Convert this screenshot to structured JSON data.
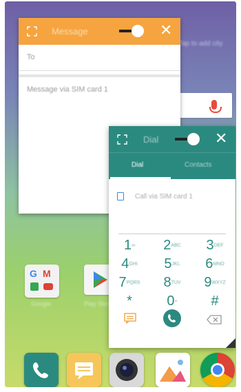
{
  "message_window": {
    "title": "Message",
    "to_label": "To",
    "compose_placeholder": "Message via SIM card 1"
  },
  "dial_window": {
    "title": "Dial",
    "tabs": [
      "Dial",
      "Contacts"
    ],
    "sim_hint": "Call via SIM card 1",
    "keys": [
      {
        "d": "1",
        "s": "∞"
      },
      {
        "d": "2",
        "s": "ABC"
      },
      {
        "d": "3",
        "s": "DEF"
      },
      {
        "d": "4",
        "s": "GHI"
      },
      {
        "d": "5",
        "s": "JKL"
      },
      {
        "d": "6",
        "s": "MNO"
      },
      {
        "d": "7",
        "s": "PQRS"
      },
      {
        "d": "8",
        "s": "TUV"
      },
      {
        "d": "9",
        "s": "WXYZ"
      },
      {
        "d": "*",
        "s": ""
      },
      {
        "d": "0",
        "s": "+"
      },
      {
        "d": "#",
        "s": ""
      }
    ]
  },
  "home": {
    "search_hint": "Tap to add city",
    "apps": [
      "Google",
      "Play Store"
    ]
  },
  "colors": {
    "message_accent": "#f5a43f",
    "dial_accent": "#2b8a7f"
  }
}
